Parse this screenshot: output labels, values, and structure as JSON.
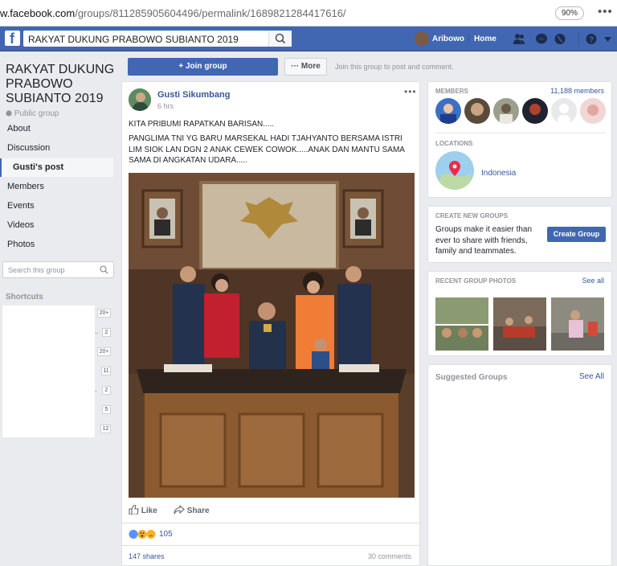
{
  "browser": {
    "url_host": "w.facebook.com",
    "url_path": "/groups/811285905604496/permalink/1689821284417616/",
    "zoom": "90%",
    "menu": "•••"
  },
  "topbar": {
    "search_value": "RAKYAT DUKUNG PRABOWO SUBIANTO 2019",
    "user_name": "Aribowo",
    "home": "Home",
    "brand_color": "#4267b2"
  },
  "group": {
    "title": "RAKYAT DUKUNG PRABOWO SUBIANTO 2019",
    "privacy": "Public group"
  },
  "left_nav": [
    {
      "label": "About"
    },
    {
      "label": "Discussion"
    },
    {
      "label": "Gusti's post",
      "active": true
    },
    {
      "label": "Members"
    },
    {
      "label": "Events"
    },
    {
      "label": "Videos"
    },
    {
      "label": "Photos"
    }
  ],
  "left_search": {
    "placeholder": "Search this group"
  },
  "shortcuts": {
    "heading": "Shortcuts",
    "badges": [
      "20+",
      "2",
      "20+",
      "11",
      "2",
      "5",
      "12"
    ]
  },
  "actions": {
    "join": "+ Join group",
    "more": "··· More",
    "hint": "Join this group to post and comment."
  },
  "post": {
    "author": "Gusti Sikumbang",
    "time": "6 hrs",
    "menu": "•••",
    "line1": "KITA PRIBUMI RAPATKAN BARISAN.....",
    "line2": "PANGLIMA TNI YG BARU MARSEKAL HADI TJAHYANTO BERSAMA ISTRI LIM SIOK LAN DGN 2 ANAK CEWEK COWOK.....ANAK DAN MANTU SAMA SAMA DI ANGKATAN UDARA.....",
    "like": "Like",
    "share": "Share",
    "reaction_count": "105",
    "shares": "147 shares",
    "comments": "30 comments"
  },
  "members_box": {
    "heading": "MEMBERS",
    "count": "11,188 members"
  },
  "locations_box": {
    "heading": "LOCATIONS",
    "place": "Indonesia"
  },
  "create_box": {
    "heading": "CREATE NEW GROUPS",
    "text": "Groups make it easier than ever to share with friends, family and teammates.",
    "button": "Create Group"
  },
  "photos_box": {
    "heading": "RECENT GROUP PHOTOS",
    "see_all": "See all"
  },
  "suggested_box": {
    "heading": "Suggested Groups",
    "see_all": "See All"
  }
}
